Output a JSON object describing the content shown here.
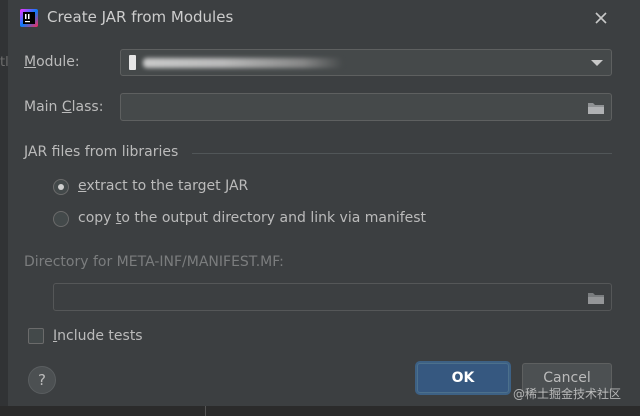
{
  "window": {
    "title": "Create JAR from Modules",
    "background_left_text": "tl"
  },
  "form": {
    "module_label_mnemonic": "M",
    "module_label_rest": "odule:",
    "module_value": "",
    "main_class_label_pre": "Main ",
    "main_class_label_mnemonic": "C",
    "main_class_label_post": "lass:",
    "main_class_value": "",
    "jar_section_title": "JAR files from libraries",
    "radio_extract_mnemonic": "e",
    "radio_extract_rest": "xtract to the target JAR",
    "radio_copy_pre": "copy ",
    "radio_copy_mnemonic": "t",
    "radio_copy_rest": "o the output directory and link via manifest",
    "selected_option": "extract",
    "manifest_dir_label": "Directory for META-INF/MANIFEST.MF:",
    "manifest_dir_value": "",
    "include_tests_mnemonic": "I",
    "include_tests_rest": "nclude tests",
    "include_tests_checked": false
  },
  "buttons": {
    "help": "?",
    "ok": "OK",
    "cancel": "Cancel"
  },
  "watermark": "@稀土掘金技术社区",
  "colors": {
    "dialog_bg": "#3c3f41",
    "text": "#bbbbbb",
    "disabled_text": "#7b7d7e",
    "ok_button_bg": "#365880",
    "field_bg": "#45494a"
  },
  "icons": {
    "app": "intellij-idea-icon",
    "close": "close-icon",
    "browse": "folder-icon",
    "dropdown": "chevron-down-icon"
  }
}
